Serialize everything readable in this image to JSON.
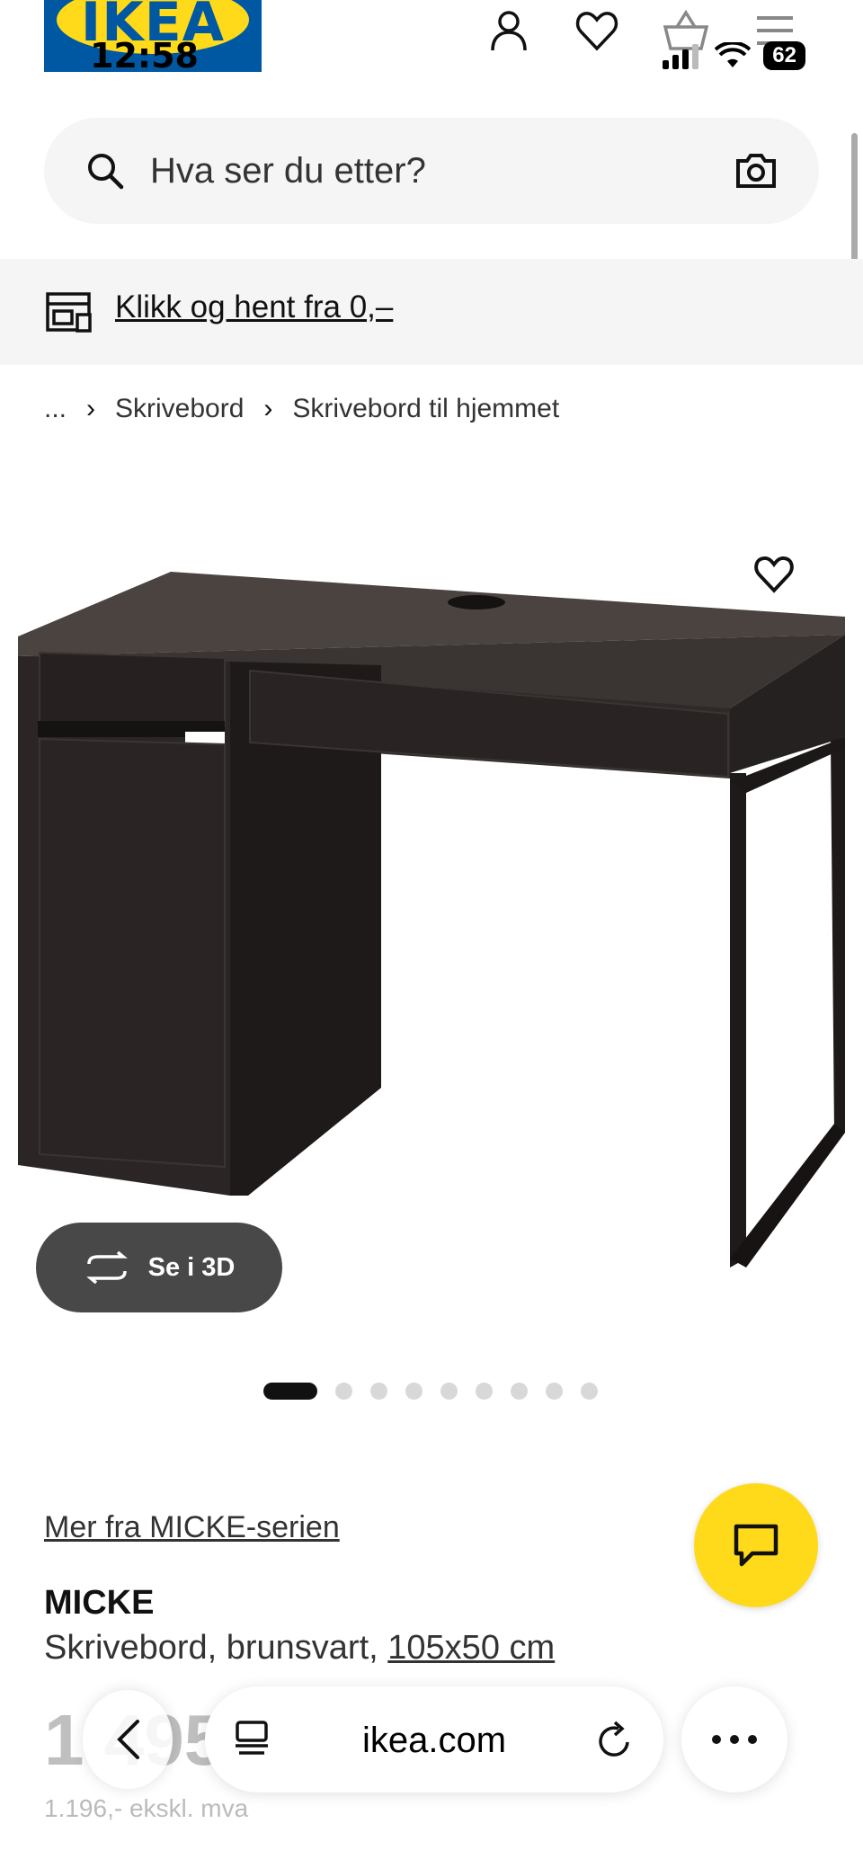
{
  "header": {
    "logo_text": "IKEA",
    "time": "12:58",
    "battery": "62",
    "icons": [
      "person-icon",
      "heart-icon",
      "basket-icon",
      "menu-icon"
    ]
  },
  "search": {
    "placeholder": "Hva ser du etter?"
  },
  "promo": {
    "text": "Klikk og hent fra 0,–"
  },
  "breadcrumb": {
    "ellipsis": "...",
    "items": [
      "Skrivebord",
      "Skrivebord til hjemmet"
    ]
  },
  "gallery": {
    "view3d_label": "Se i 3D",
    "slide_count": 10,
    "active_slide": 1
  },
  "product": {
    "series_link": "Mer fra MICKE-serien",
    "name": "MICKE",
    "description": "Skrivebord, brunsvart,",
    "dimensions": "105x50 cm",
    "price": "1 495",
    "price_ex_vat": "1.196,- ekskl. mva"
  },
  "browser": {
    "url": "ikea.com"
  },
  "colors": {
    "brand_blue": "#0058A3",
    "brand_yellow": "#FFDA1A"
  }
}
